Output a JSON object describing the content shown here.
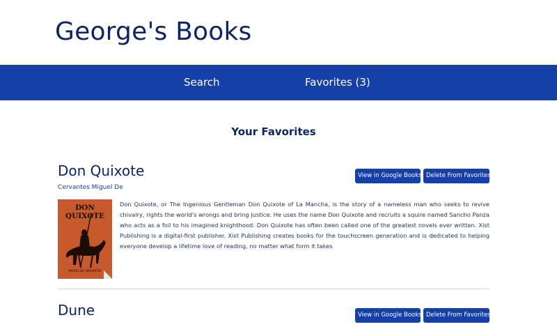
{
  "header": {
    "title": "George's Books"
  },
  "nav": {
    "search": "Search",
    "favorites": "Favorites (3)"
  },
  "main": {
    "section_title": "Your Favorites",
    "view_label": "View in Google Books",
    "delete_label": "Delete From Favorites",
    "books": [
      {
        "title": "Don Quixote",
        "author": "Cervantes Miguel De",
        "cover_title": "DON QUIXOTE",
        "cover_author": "MIGUEL DE CERVANTES",
        "description": "Don Quixote, or The Ingenious Gentleman Don Quixote of La Mancha, is the story of a nameless man who seeks to revive chivalry, rights the world's wrongs and bring justice. He uses the name Don Quixote and recruits a squire named Sancho Panza who acts as a foil to his imagined knighthood. Don Quixote has often been called one of the greatest novels ever written. Xist Publishing is a digital-first publisher. Xist Publishing creates books for the touchscreen generation and is dedicated to helping everyone develop a lifetime love of reading, no matter what form it takes"
      },
      {
        "title": "Dune"
      }
    ]
  },
  "colors": {
    "primary": "#1440a8",
    "text": "#0d2566",
    "cover": "#c65a2c"
  }
}
